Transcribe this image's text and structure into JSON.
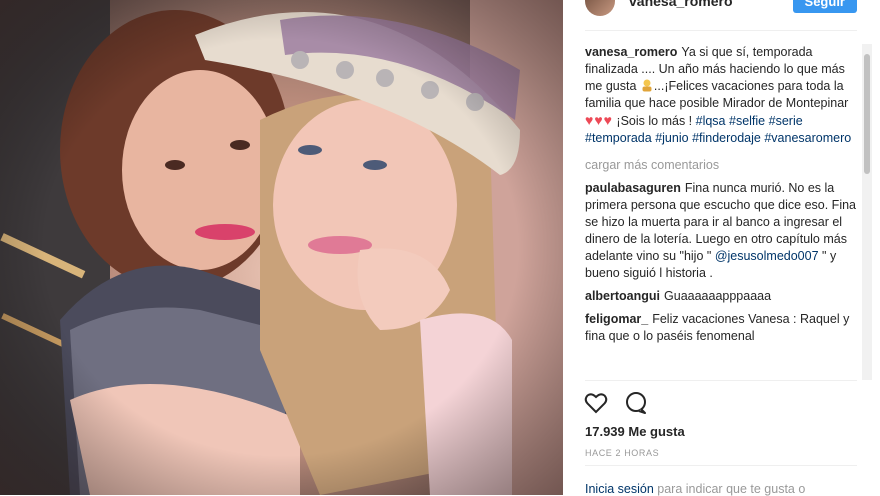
{
  "post": {
    "username": "vanesa_romero",
    "follow_label": "Seguir",
    "caption_user": "vanesa_romero",
    "caption_text_1": "Ya si que sí, temporada finalizada .... Un año más haciendo lo que más me gusta",
    "caption_text_2": "...¡Felices vacaciones para toda la familia que hace posible Mirador de Montepinar",
    "caption_hearts": "♥♥♥",
    "caption_text_3": "¡Sois lo más !",
    "hashtags": [
      "#lqsa",
      "#selfie",
      "#serie",
      "#temporada",
      "#junio",
      "#finderodaje",
      "#vanesaromero"
    ],
    "load_more": "cargar más comentarios",
    "comments": [
      {
        "user": "paulabasaguren",
        "text_1": "Fina nunca murió. No es la primera persona que escucho que dice eso. Fina se hizo la muerta para ir al banco a ingresar el dinero de la lotería. Luego en otro capítulo más adelante vino su \"hijo \"",
        "mention": "@jesusolmedo007",
        "text_2": "\" y bueno siguió l historia ."
      },
      {
        "user": "albertoangui",
        "text": "Guaaaaaapppaaaa"
      },
      {
        "user": "feligomar_",
        "text": "Feliz vacaciones Vanesa : Raquel y fina que o lo paséis fenomenal"
      }
    ],
    "likes": "17.939 Me gusta",
    "time": "HACE 2 HORAS",
    "login_link": "Inicia sesión",
    "login_text": "para indicar que te gusta o"
  },
  "icons": {
    "like": "heart-outline-icon",
    "comment": "speech-bubble-icon"
  },
  "colors": {
    "link": "#003569",
    "follow": "#3897f0",
    "heart": "#ed4956"
  }
}
